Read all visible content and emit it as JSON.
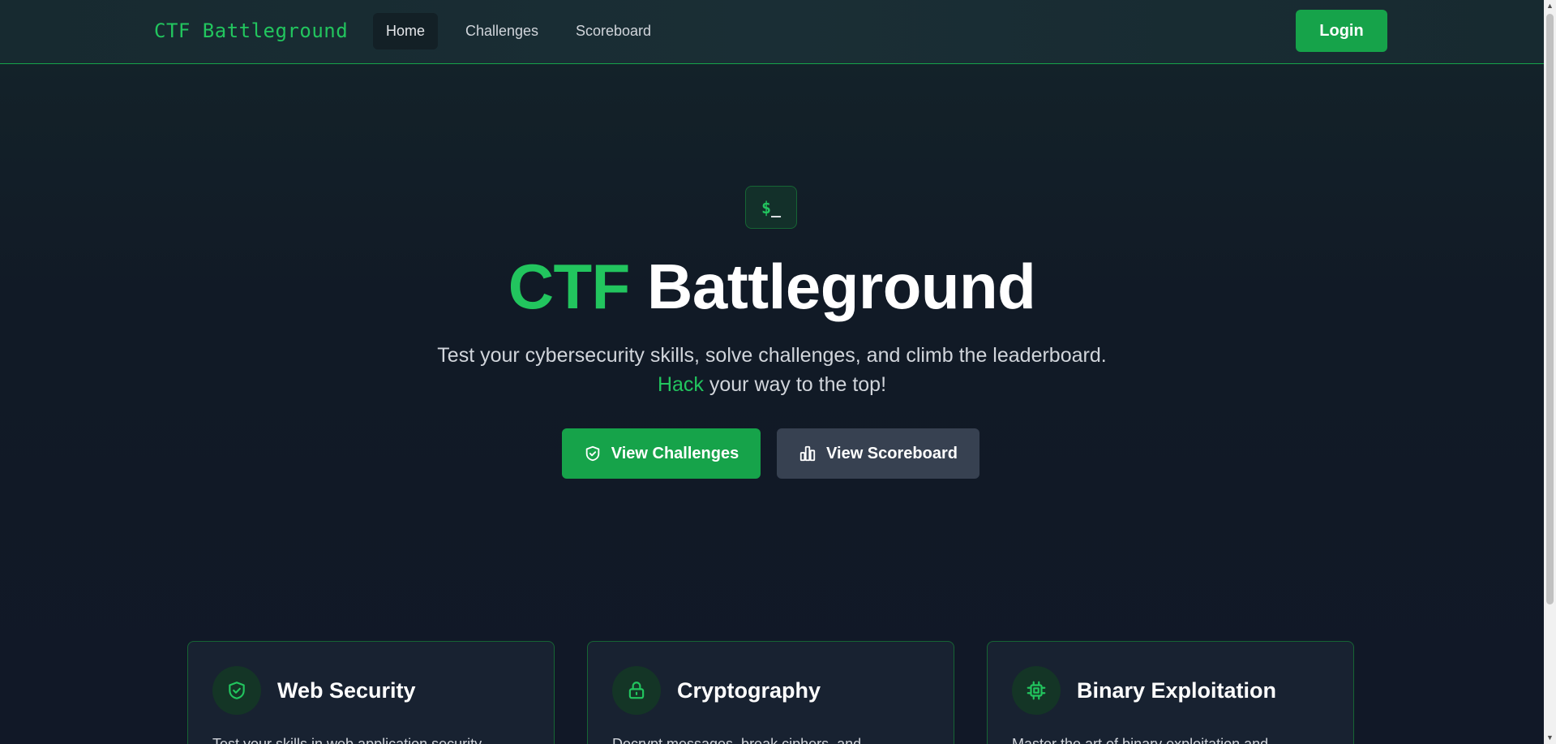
{
  "nav": {
    "brand": "CTF Battleground",
    "links": [
      {
        "label": "Home",
        "active": true
      },
      {
        "label": "Challenges",
        "active": false
      },
      {
        "label": "Scoreboard",
        "active": false
      }
    ],
    "login_label": "Login"
  },
  "hero": {
    "terminal_prompt": "$",
    "terminal_cursor": "_",
    "title_accent": "CTF",
    "title_rest": "Battleground",
    "subtitle_line1": "Test your cybersecurity skills, solve challenges, and climb the leaderboard.",
    "subtitle_accent": "Hack",
    "subtitle_line2_rest": "your way to the top!",
    "primary_button": {
      "label": "View Challenges",
      "icon": "shield-icon"
    },
    "secondary_button": {
      "label": "View Scoreboard",
      "icon": "bar-chart-icon"
    }
  },
  "cards": [
    {
      "title": "Web Security",
      "icon": "shield-check-icon",
      "description": "Test your skills in web application security"
    },
    {
      "title": "Cryptography",
      "icon": "lock-icon",
      "description": "Decrypt messages, break ciphers, and"
    },
    {
      "title": "Binary Exploitation",
      "icon": "cpu-icon",
      "description": "Master the art of binary exploitation and"
    }
  ],
  "colors": {
    "accent": "#22c55e",
    "accent_button": "#16a34a",
    "secondary_button": "#374151",
    "background": "#111827"
  }
}
